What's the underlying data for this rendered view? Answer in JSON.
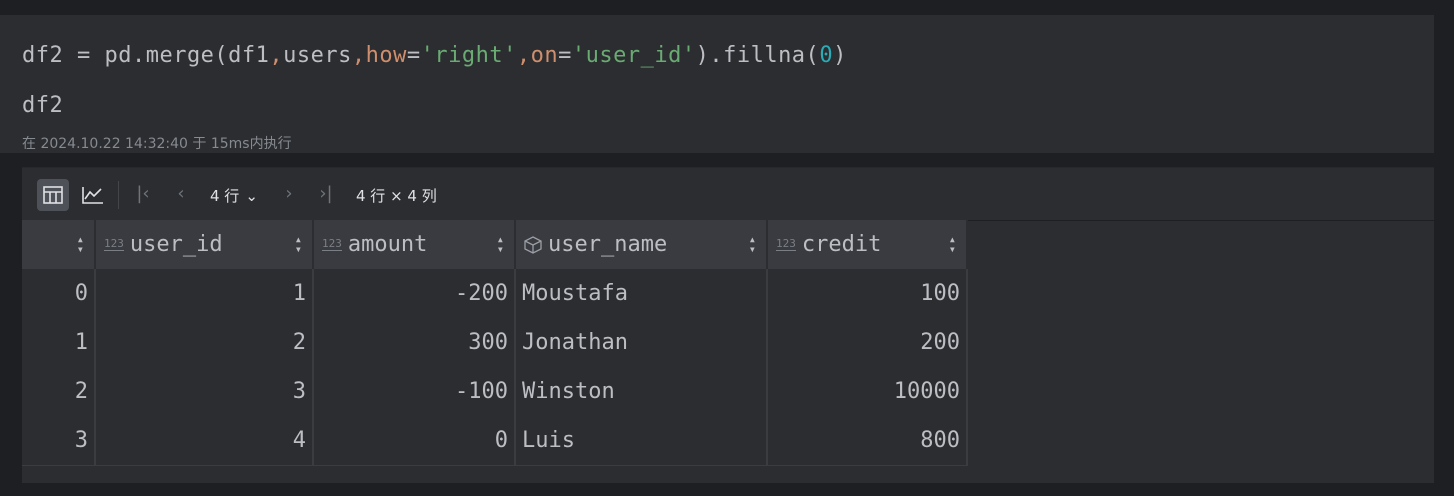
{
  "code": {
    "line1": [
      {
        "t": "df2 = pd.merge(df1",
        "c": "plain"
      },
      {
        "t": ",",
        "c": "kw"
      },
      {
        "t": "users",
        "c": "plain"
      },
      {
        "t": ",",
        "c": "kw"
      },
      {
        "t": "how",
        "c": "kw"
      },
      {
        "t": "=",
        "c": "plain"
      },
      {
        "t": "'right'",
        "c": "str"
      },
      {
        "t": ",",
        "c": "kw"
      },
      {
        "t": "on",
        "c": "kw"
      },
      {
        "t": "=",
        "c": "plain"
      },
      {
        "t": "'user_id'",
        "c": "str"
      },
      {
        "t": ").fillna(",
        "c": "plain"
      },
      {
        "t": "0",
        "c": "num"
      },
      {
        "t": ")",
        "c": "plain"
      }
    ],
    "line2": "df2"
  },
  "exec_info": "在 2024.10.22 14:32:40 于 15ms内执行",
  "toolbar": {
    "rows_selector": "4 行",
    "shape": "4 行 × 4 列"
  },
  "table": {
    "columns": [
      {
        "name": "user_id",
        "type_icon": "123"
      },
      {
        "name": "amount",
        "type_icon": "123"
      },
      {
        "name": "user_name",
        "type_icon": "cube"
      },
      {
        "name": "credit",
        "type_icon": "123"
      }
    ],
    "rows": [
      {
        "index": "0",
        "user_id": "1",
        "amount": "-200",
        "user_name": "Moustafa",
        "credit": "100"
      },
      {
        "index": "1",
        "user_id": "2",
        "amount": "300",
        "user_name": "Jonathan",
        "credit": "200"
      },
      {
        "index": "2",
        "user_id": "3",
        "amount": "-100",
        "user_name": "Winston",
        "credit": "10000"
      },
      {
        "index": "3",
        "user_id": "4",
        "amount": "0",
        "user_name": "Luis",
        "credit": "800"
      }
    ]
  },
  "colors": {
    "keyword": "#cf8e6d",
    "string": "#6aab73",
    "number": "#2aacb8",
    "text": "#bcbec4"
  }
}
